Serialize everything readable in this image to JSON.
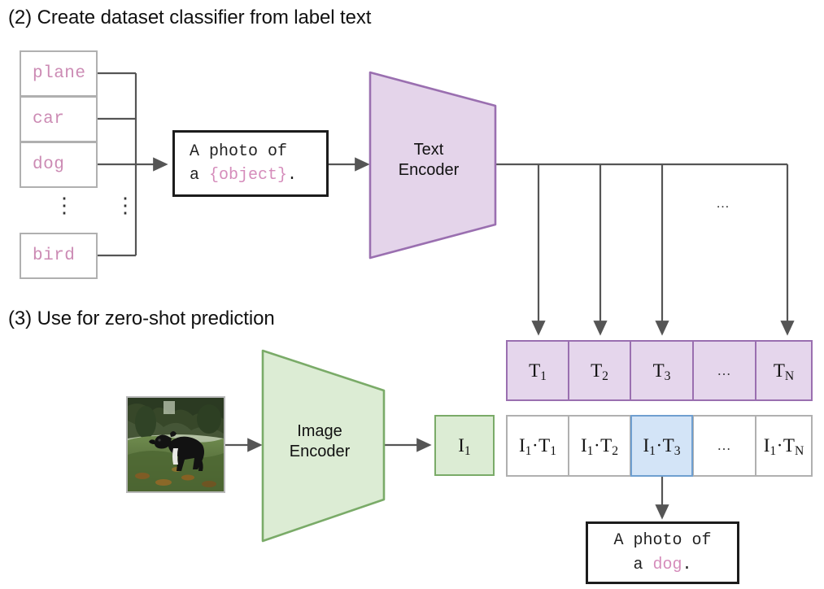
{
  "sections": {
    "step2_heading": "(2) Create dataset classifier from label text",
    "step3_heading": "(3) Use for zero-shot prediction"
  },
  "labels": {
    "items": [
      {
        "text": "plane"
      },
      {
        "text": "car"
      },
      {
        "text": "dog"
      },
      {
        "text": "bird"
      }
    ],
    "ellipsis": "⋮"
  },
  "prompt": {
    "line1": "A photo of",
    "line2_prefix": "a ",
    "line2_slot": "{object}",
    "line2_suffix": "."
  },
  "text_encoder": {
    "line1": "Text",
    "line2": "Encoder",
    "fill": "#e4d4ea",
    "stroke": "#9a6fb0"
  },
  "image_encoder": {
    "line1": "Image",
    "line2": "Encoder",
    "fill": "#dcecd4",
    "stroke": "#7aab68"
  },
  "text_embeddings": {
    "cells": [
      {
        "base": "T",
        "sub": "1"
      },
      {
        "base": "T",
        "sub": "2"
      },
      {
        "base": "T",
        "sub": "3"
      },
      {
        "base": "…",
        "sub": ""
      },
      {
        "base": "T",
        "sub": "N"
      }
    ],
    "fill": "#e5d6ec",
    "stroke": "#9a6fb0"
  },
  "image_embedding": {
    "base": "I",
    "sub": "1",
    "fill": "#dcecd4",
    "stroke": "#7aab68"
  },
  "similarity_row": {
    "cells": [
      {
        "left_base": "I",
        "left_sub": "1",
        "op": "·",
        "right_base": "T",
        "right_sub": "1",
        "highlighted": false
      },
      {
        "left_base": "I",
        "left_sub": "1",
        "op": "·",
        "right_base": "T",
        "right_sub": "2",
        "highlighted": false
      },
      {
        "left_base": "I",
        "left_sub": "1",
        "op": "·",
        "right_base": "T",
        "right_sub": "3",
        "highlighted": true
      },
      {
        "left_base": "…",
        "left_sub": "",
        "op": "",
        "right_base": "",
        "right_sub": "",
        "highlighted": false
      },
      {
        "left_base": "I",
        "left_sub": "1",
        "op": "·",
        "right_base": "T",
        "right_sub": "N",
        "highlighted": false
      }
    ],
    "highlight_fill": "#d3e4f7",
    "highlight_stroke": "#6f9fd0",
    "stroke": "#b0b0b0"
  },
  "fanout": {
    "ellipsis": "…"
  },
  "prediction": {
    "line1": "A photo of",
    "line2_prefix": "a ",
    "line2_slot": "dog",
    "line2_suffix": "."
  },
  "photo": {
    "alt": "photo-of-black-dog-in-grass"
  },
  "colors": {
    "label_text": "#cc8bb4",
    "slot_text": "#d58cbb",
    "connector": "#555555",
    "box_border": "#b0b0b0",
    "dark_border": "#1c1c1c"
  }
}
